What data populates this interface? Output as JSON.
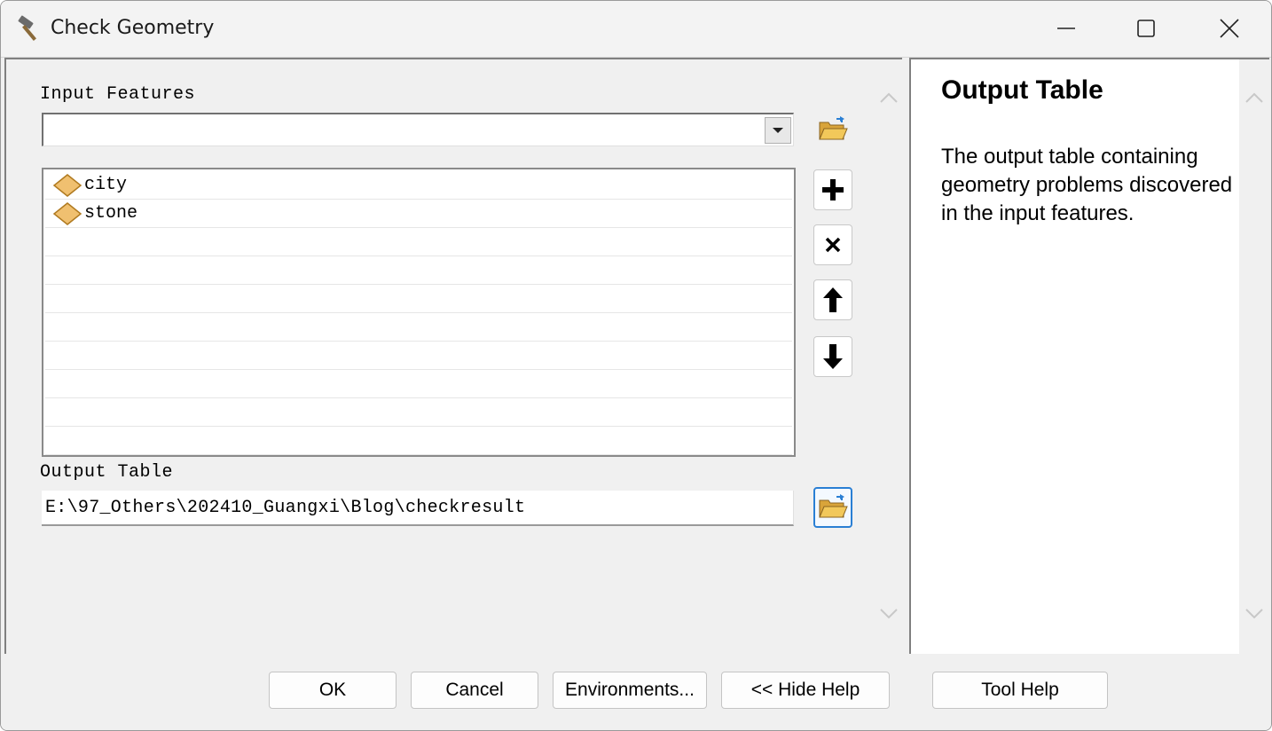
{
  "window": {
    "title": "Check Geometry",
    "minimize_icon": "minimize-icon",
    "maximize_icon": "maximize-icon",
    "close_icon": "close-icon"
  },
  "input_features": {
    "label": "Input Features",
    "combo_value": "",
    "browse_icon": "folder-open-icon",
    "items": [
      {
        "name": "city",
        "icon": "feature-layer-icon"
      },
      {
        "name": "stone",
        "icon": "feature-layer-icon"
      }
    ],
    "empty_rows": 8
  },
  "list_buttons": {
    "add": "plus-icon",
    "remove": "x-icon",
    "move_up": "arrow-up-icon",
    "move_down": "arrow-down-icon"
  },
  "output_table": {
    "label": "Output Table",
    "value": "E:\\97_Others\\202410_Guangxi\\Blog\\checkresult",
    "browse_icon": "folder-open-icon"
  },
  "help_panel": {
    "title": "Output Table",
    "body": "The output table containing geometry problems discovered in the input features."
  },
  "buttons": {
    "ok": "OK",
    "cancel": "Cancel",
    "environments": "Environments...",
    "hide_help": "<< Hide Help",
    "tool_help": "Tool Help"
  },
  "colors": {
    "accent": "#2a7fd4",
    "folder": "#e8b84a",
    "feature_icon": "#e8b860"
  }
}
